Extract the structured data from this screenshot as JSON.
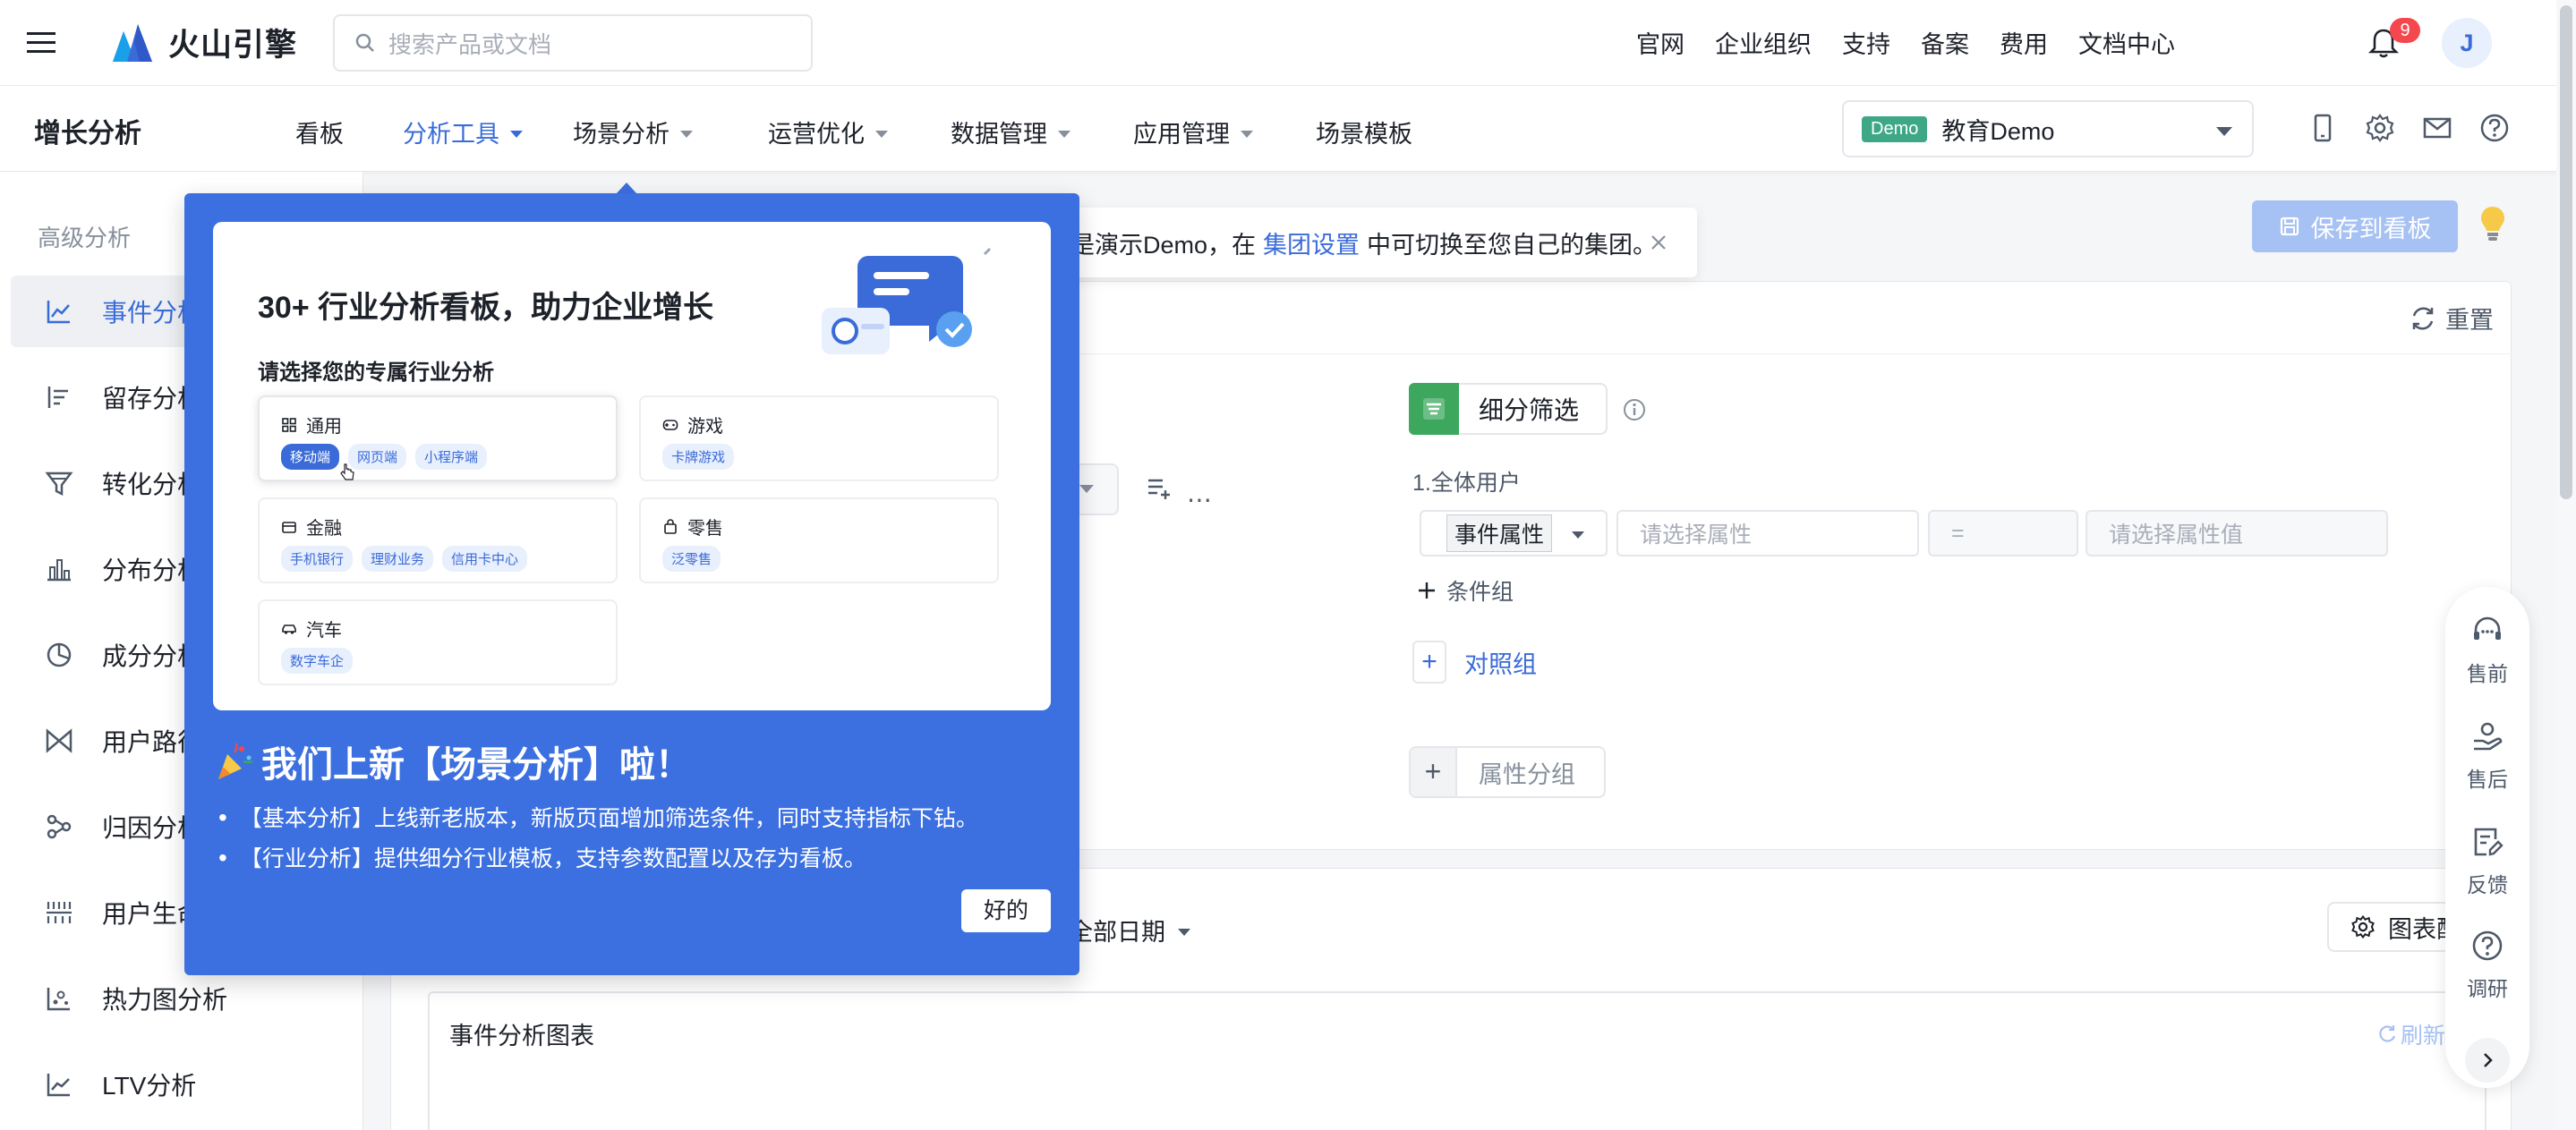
{
  "header": {
    "logo_text": "火山引擎",
    "search_placeholder": "搜索产品或文档",
    "nav": [
      "官网",
      "企业组织",
      "支持",
      "备案",
      "费用",
      "文档中心"
    ],
    "notification_count": "9",
    "avatar_initial": "J"
  },
  "subnav": {
    "product_title": "增长分析",
    "menu": [
      {
        "label": "看板",
        "has_caret": false,
        "active": false
      },
      {
        "label": "分析工具",
        "has_caret": true,
        "active": true
      },
      {
        "label": "场景分析",
        "has_caret": true,
        "active": false
      },
      {
        "label": "运营优化",
        "has_caret": true,
        "active": false
      },
      {
        "label": "数据管理",
        "has_caret": true,
        "active": false
      },
      {
        "label": "应用管理",
        "has_caret": true,
        "active": false
      },
      {
        "label": "场景模板",
        "has_caret": false,
        "active": false
      }
    ],
    "demo_tag": "Demo",
    "demo_name": "教育Demo"
  },
  "sidebar": {
    "heading": "高级分析",
    "items": [
      {
        "label": "事件分析",
        "icon": "line-chart-icon",
        "active": true
      },
      {
        "label": "留存分析",
        "icon": "retention-icon",
        "active": false
      },
      {
        "label": "转化分析",
        "icon": "funnel-icon",
        "active": false
      },
      {
        "label": "分布分析",
        "icon": "bar-chart-icon",
        "active": false
      },
      {
        "label": "成分分析",
        "icon": "pie-chart-icon",
        "active": false
      },
      {
        "label": "用户路径",
        "icon": "path-icon",
        "active": false
      },
      {
        "label": "归因分析",
        "icon": "attribution-icon",
        "active": false
      },
      {
        "label": "用户生命周期",
        "icon": "lifecycle-icon",
        "active": false
      },
      {
        "label": "热力图分析",
        "icon": "heatmap-icon",
        "active": false
      },
      {
        "label": "LTV分析",
        "icon": "ltv-icon",
        "active": false
      }
    ]
  },
  "main": {
    "notice_prefix": "是演示Demo，在",
    "notice_link": "集团设置",
    "notice_suffix": "中可切换至您自己的集团。",
    "save_label": "保存到看板",
    "reset_label": "重置",
    "segment_label": "细分筛选",
    "all_users_label": "1.全体用户",
    "filter_type_label": "事件属性",
    "filter_prop_placeholder": "请选择属性",
    "filter_op": "=",
    "filter_val_placeholder": "请选择属性值",
    "cond_group_label": "条件组",
    "compare_group_label": "对照组",
    "attr_group_label": "属性分组",
    "date_label": "全部日期",
    "chart_settings_label": "图表配置",
    "chart_title": "事件分析图表",
    "refresh_label": "刷新"
  },
  "helpbar": {
    "items": [
      {
        "label": "售前",
        "icon": "headset-icon"
      },
      {
        "label": "售后",
        "icon": "service-icon"
      },
      {
        "label": "反馈",
        "icon": "feedback-icon"
      },
      {
        "label": "调研",
        "icon": "question-icon"
      }
    ]
  },
  "popover": {
    "preview_title": "30+ 行业分析看板，助力企业增长",
    "preview_subtitle": "请选择您的专属行业分析",
    "industries": [
      {
        "name": "通用",
        "tags": [
          "移动端",
          "网页端",
          "小程序端"
        ],
        "selected_tag": "移动端"
      },
      {
        "name": "游戏",
        "tags": [
          "卡牌游戏"
        ],
        "selected_tag": ""
      },
      {
        "name": "金融",
        "tags": [
          "手机银行",
          "理财业务",
          "信用卡中心"
        ],
        "selected_tag": ""
      },
      {
        "name": "零售",
        "tags": [
          "泛零售"
        ],
        "selected_tag": ""
      },
      {
        "name": "汽车",
        "tags": [
          "数字车企"
        ],
        "selected_tag": ""
      }
    ],
    "release_title": "我们上新【场景分析】啦！",
    "release_items": [
      "【基本分析】上线新老版本，新版页面增加筛选条件，同时支持指标下钻。",
      "【行业分析】提供细分行业模板，支持参数配置以及存为看板。"
    ],
    "ok_label": "好的"
  },
  "colors": {
    "accent": "#3a6bd8",
    "popover_bg": "#3c70e0",
    "demo_tag": "#3da786",
    "segment_green": "#3da75e",
    "badge_red": "#f5474e"
  }
}
